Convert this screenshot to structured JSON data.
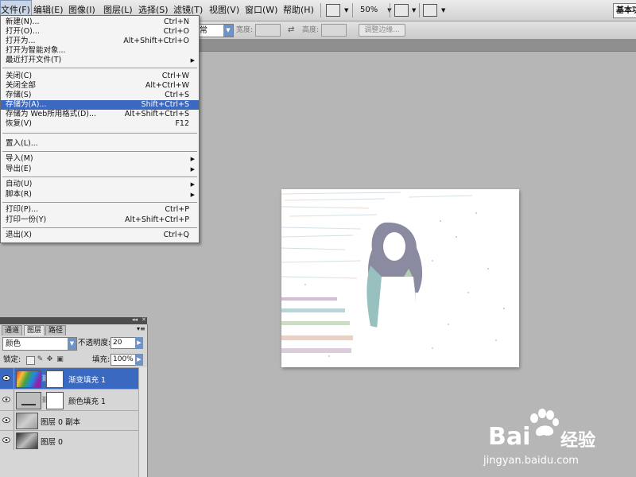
{
  "menubar": {
    "items": [
      "文件(F)",
      "编辑(E)",
      "图像(I)",
      "图层(L)",
      "选择(S)",
      "滤镜(T)",
      "视图(V)",
      "窗口(W)",
      "帮助(H)"
    ],
    "active_index": 0,
    "zoom_label": "50%",
    "workspace_label": "基本功"
  },
  "options_bar": {
    "style_value": "常",
    "width_label": "宽度:",
    "height_label": "高度:",
    "refine_edge_label": "调整边缘..."
  },
  "file_menu": {
    "items": [
      {
        "label": "新建(N)...",
        "shortcut": "Ctrl+N",
        "submenu": false
      },
      {
        "label": "打开(O)...",
        "shortcut": "Ctrl+O",
        "submenu": false
      },
      {
        "label": "打开为...",
        "shortcut": "Alt+Shift+Ctrl+O",
        "submenu": false
      },
      {
        "label": "打开为智能对象...",
        "shortcut": "",
        "submenu": false
      },
      {
        "label": "最近打开文件(T)",
        "shortcut": "",
        "submenu": true
      },
      {
        "label": "关闭(C)",
        "shortcut": "Ctrl+W",
        "submenu": false
      },
      {
        "label": "关闭全部",
        "shortcut": "Alt+Ctrl+W",
        "submenu": false
      },
      {
        "label": "存储(S)",
        "shortcut": "Ctrl+S",
        "submenu": false
      },
      {
        "label": "存储为(A)...",
        "shortcut": "Shift+Ctrl+S",
        "submenu": false
      },
      {
        "label": "存储为 Web所用格式(D)...",
        "shortcut": "Alt+Shift+Ctrl+S",
        "submenu": false
      },
      {
        "label": "恢复(V)",
        "shortcut": "F12",
        "submenu": false
      },
      {
        "label": "置入(L)...",
        "shortcut": "",
        "submenu": false
      },
      {
        "label": "导入(M)",
        "shortcut": "",
        "submenu": true
      },
      {
        "label": "导出(E)",
        "shortcut": "",
        "submenu": true
      },
      {
        "label": "自动(U)",
        "shortcut": "",
        "submenu": true
      },
      {
        "label": "脚本(R)",
        "shortcut": "",
        "submenu": true
      },
      {
        "label": "打印(P)...",
        "shortcut": "Ctrl+P",
        "submenu": false
      },
      {
        "label": "打印一份(Y)",
        "shortcut": "Alt+Shift+Ctrl+P",
        "submenu": false
      },
      {
        "label": "退出(X)",
        "shortcut": "Ctrl+Q",
        "submenu": false
      }
    ],
    "highlighted_index": 8
  },
  "layers_panel": {
    "tabs": [
      "通道",
      "图层",
      "路径"
    ],
    "active_tab_index": 1,
    "blend_mode": "颜色",
    "opacity_label": "不透明度:",
    "opacity_value": "20",
    "lock_label": "锁定:",
    "fill_label": "填充:",
    "fill_value": "100%",
    "layers": [
      {
        "name": "渐变填充 1",
        "selected": true
      },
      {
        "name": "颜色填充 1",
        "selected": false
      },
      {
        "name": "图层 0 副本",
        "selected": false
      },
      {
        "name": "图层 0",
        "selected": false
      }
    ]
  },
  "watermark": {
    "brand": "Bai",
    "brand2": "经验",
    "url": "jingyan.baidu.com"
  },
  "colors": {
    "selection": "#3a69c2",
    "canvas_bg": "#b6b6b6",
    "dropdown_accent": "#6f93c6"
  },
  "icons": [
    "eye-icon",
    "chain-icon",
    "lock-transparent-icon",
    "brush-lock-icon",
    "move-lock-icon",
    "lock-all-icon",
    "swap-icon",
    "panel-menu-icon"
  ]
}
